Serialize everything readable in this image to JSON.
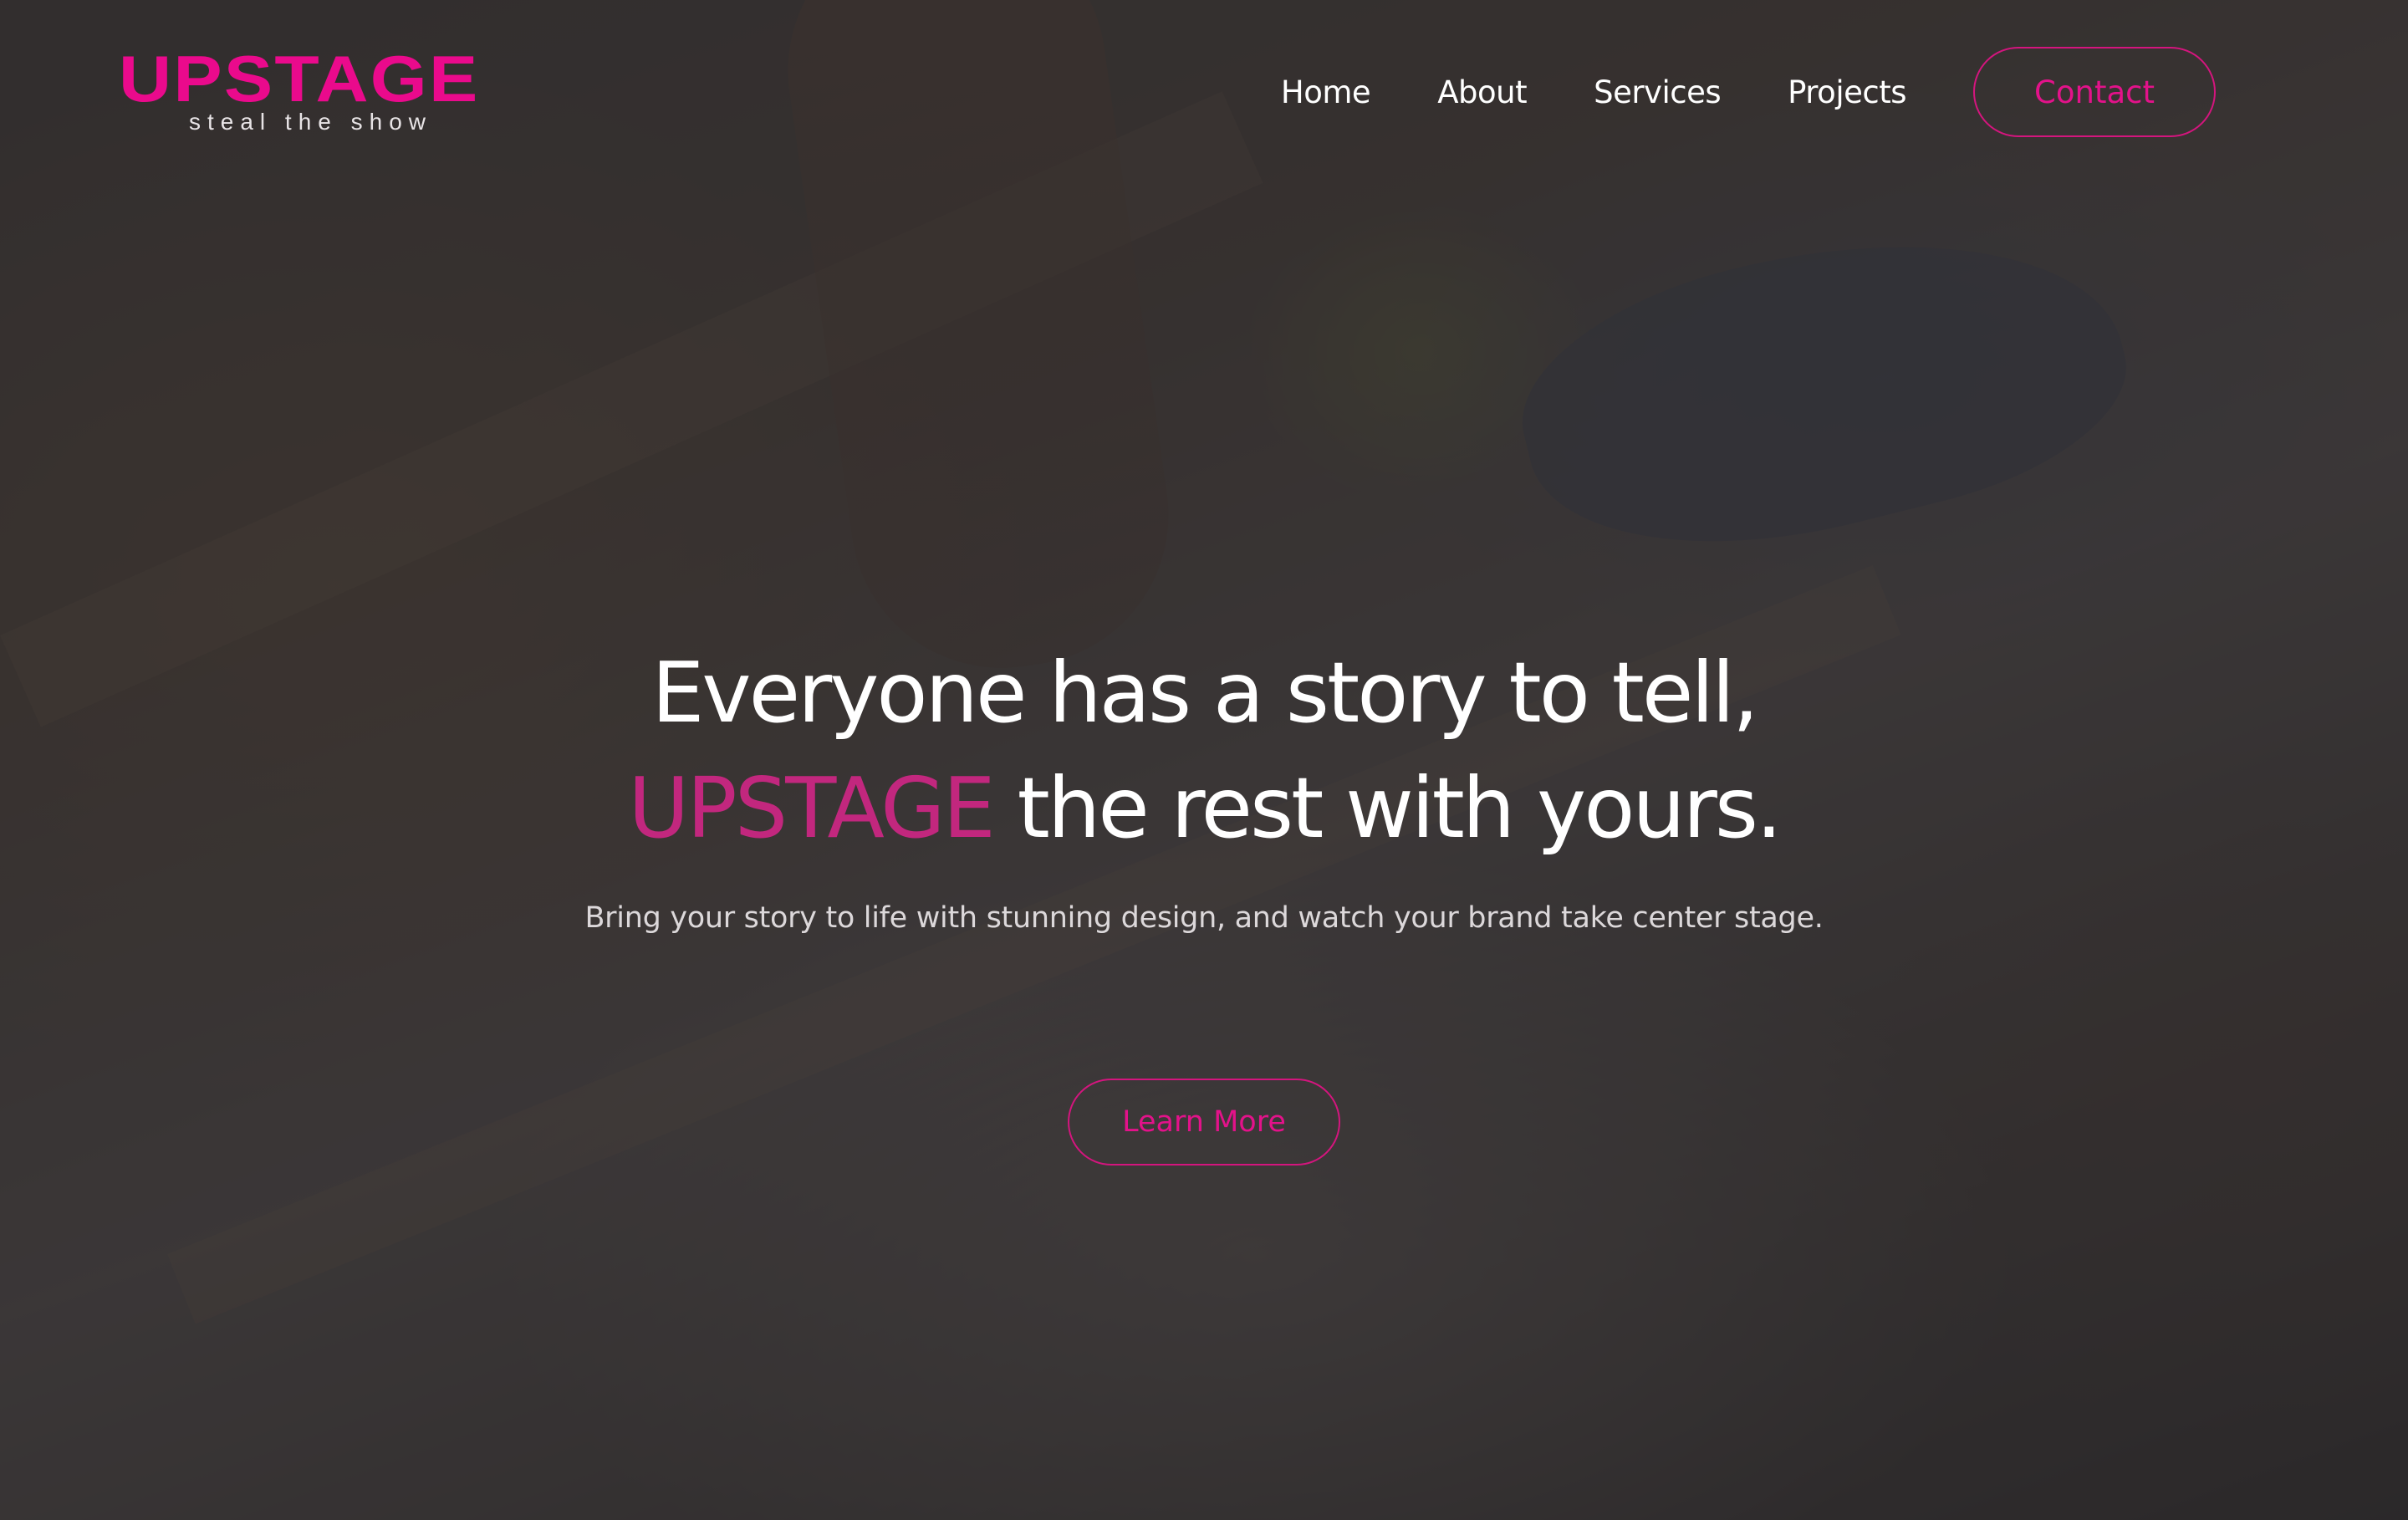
{
  "brand": {
    "name": "UPSTAGE",
    "tagline": "steal the show",
    "accent_color": "#ea0a8c"
  },
  "nav": {
    "items": [
      {
        "label": "Home"
      },
      {
        "label": "About"
      },
      {
        "label": "Services"
      },
      {
        "label": "Projects"
      }
    ],
    "contact_label": "Contact"
  },
  "hero": {
    "headline_line1": "Everyone has a story to tell,",
    "headline_accent": "UPSTAGE",
    "headline_line2_rest": " the rest with yours.",
    "subheadline": "Bring your story to life with stunning design, and watch your brand take center stage.",
    "cta_label": "Learn More"
  }
}
